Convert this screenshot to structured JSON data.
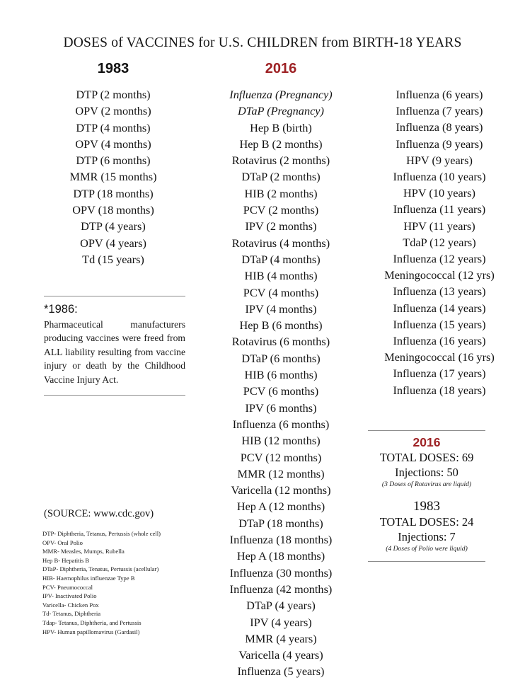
{
  "title": "DOSES of VACCINES for U.S. CHILDREN from BIRTH-18 YEARS",
  "colors": {
    "accent_red": "#9e2225",
    "text_black": "#111111",
    "rule_gray": "#8c8c8c"
  },
  "columns": {
    "left": {
      "heading": "1983",
      "doses": [
        "DTP (2 months)",
        "OPV (2 months)",
        "DTP (4 months)",
        "OPV (4 months)",
        "DTP (6 months)",
        "MMR (15 months)",
        "DTP (18 months)",
        "OPV (18 months)",
        "DTP (4 years)",
        "OPV (4 years)",
        "Td (15 years)"
      ]
    },
    "middle": {
      "heading": "2016",
      "doses": [
        "Influenza (Pregnancy)",
        "DTaP (Pregnancy)",
        "Hep B (birth)",
        "Hep B (2 months)",
        "Rotavirus (2 months)",
        "DTaP (2 months)",
        "HIB (2 months)",
        "PCV (2 months)",
        "IPV (2 months)",
        "Rotavirus (4 months)",
        "DTaP (4 months)",
        "HIB (4 months)",
        "PCV (4 months)",
        "IPV (4 months)",
        "Hep B (6 months)",
        "Rotavirus (6 months)",
        "DTaP (6 months)",
        "HIB (6 months)",
        "PCV (6 months)",
        "IPV (6 months)",
        "Influenza (6 months)",
        "HIB (12 months)",
        "PCV (12 months)",
        "MMR (12 months)",
        "Varicella (12 months)",
        "Hep A (12 months)",
        "DTaP (18 months)",
        "Influenza (18 months)",
        "Hep A (18 months)",
        "Influenza (30 months)",
        "Influenza (42 months)",
        "DTaP (4 years)",
        "IPV (4 years)",
        "MMR (4 years)",
        "Varicella (4 years)",
        "Influenza (5 years)"
      ],
      "italic_indices": [
        0,
        1
      ]
    },
    "right": {
      "doses": [
        "Influenza (6 years)",
        "Influenza (7 years)",
        "Influenza (8 years)",
        "Influenza (9 years)",
        "HPV (9 years)",
        "Influenza (10 years)",
        "HPV (10 years)",
        "Influenza (11 years)",
        "HPV (11 years)",
        "TdaP (12 years)",
        "Influenza (12 years)",
        "Meningococcal (12 yrs)",
        "Influenza (13 years)",
        "Influenza (14 years)",
        "Influenza (15 years)",
        "Influenza (16 years)",
        "Meningococcal (16 yrs)",
        "Influenza (17 years)",
        "Influenza (18 years)"
      ]
    }
  },
  "note_1986": {
    "title": "*1986:",
    "body": "Pharmaceutical manufacturers producing vaccines were freed from ALL liability resulting from vaccine injury or death by the Childhood Vaccine Injury Act."
  },
  "source": "(SOURCE: www.cdc.gov)",
  "legend": [
    "DTP- Diphtheria, Tetanus, Pertussis (whole cell)",
    "OPV- Oral Polio",
    "MMR- Measles, Mumps, Rubella",
    "Hep B- Hepatitis B",
    "DTaP- Diphtheria, Tenatus, Pertussis (acellular)",
    "HIB- Haemophilus influenzae Type B",
    "PCV- Pneumococcal",
    "IPV- Inactivated Polio",
    "Varicella- Chicken Pox",
    "Td- Tetanus, Diphtheria",
    "Tdap- Tetanus, Diphtheria, and Pertussis",
    "HPV- Human papillomavirus (Gardasil)"
  ],
  "totals": {
    "y2016": {
      "year": "2016",
      "doses": "TOTAL DOSES: 69",
      "injections": "Injections: 50",
      "note": "(3 Doses of Rotavirus are liquid)"
    },
    "y1983": {
      "year": "1983",
      "doses": "TOTAL DOSES: 24",
      "injections": "Injections: 7",
      "note": "(4 Doses of Polio were liquid)"
    }
  }
}
